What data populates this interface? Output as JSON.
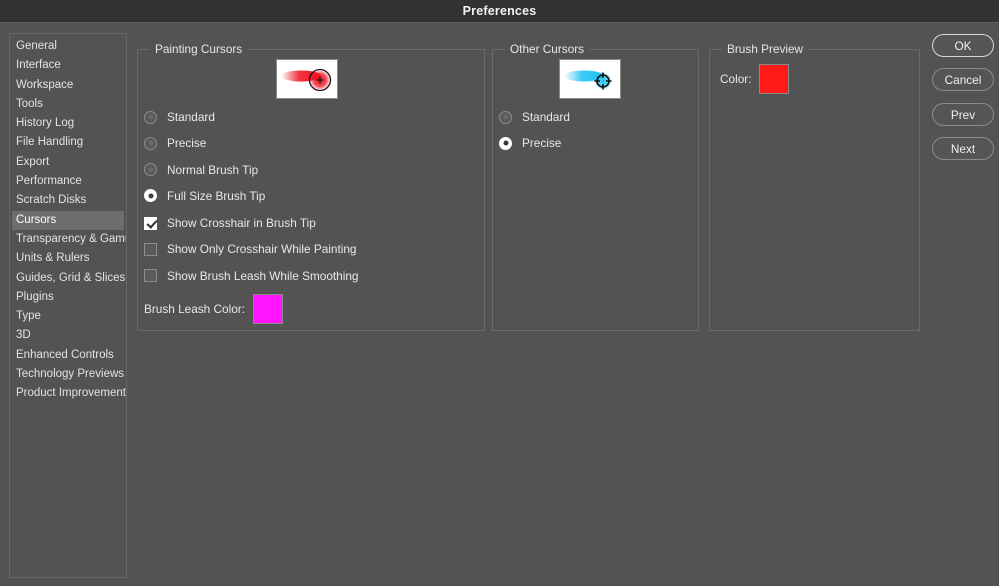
{
  "window": {
    "title": "Preferences"
  },
  "sidebar": {
    "items": [
      {
        "label": "General",
        "selected": false
      },
      {
        "label": "Interface",
        "selected": false
      },
      {
        "label": "Workspace",
        "selected": false
      },
      {
        "label": "Tools",
        "selected": false
      },
      {
        "label": "History Log",
        "selected": false
      },
      {
        "label": "File Handling",
        "selected": false
      },
      {
        "label": "Export",
        "selected": false
      },
      {
        "label": "Performance",
        "selected": false
      },
      {
        "label": "Scratch Disks",
        "selected": false
      },
      {
        "label": "Cursors",
        "selected": true
      },
      {
        "label": "Transparency & Gamut",
        "selected": false
      },
      {
        "label": "Units & Rulers",
        "selected": false
      },
      {
        "label": "Guides, Grid & Slices",
        "selected": false
      },
      {
        "label": "Plugins",
        "selected": false
      },
      {
        "label": "Type",
        "selected": false
      },
      {
        "label": "3D",
        "selected": false
      },
      {
        "label": "Enhanced Controls",
        "selected": false
      },
      {
        "label": "Technology Previews",
        "selected": false
      },
      {
        "label": "Product Improvement",
        "selected": false
      }
    ]
  },
  "painting_cursors": {
    "legend": "Painting Cursors",
    "preview_icon": "brush-stroke-red-with-crosshair-circle",
    "preview_stroke_color": "#f01020",
    "options": [
      {
        "label": "Standard",
        "selected": false
      },
      {
        "label": "Precise",
        "selected": false
      },
      {
        "label": "Normal Brush Tip",
        "selected": false
      },
      {
        "label": "Full Size Brush Tip",
        "selected": true
      }
    ],
    "checkboxes": [
      {
        "label": "Show Crosshair in Brush Tip",
        "checked": true
      },
      {
        "label": "Show Only Crosshair While Painting",
        "checked": false
      },
      {
        "label": "Show Brush Leash While Smoothing",
        "checked": false
      }
    ],
    "leash_color": {
      "label": "Brush Leash Color:",
      "value": "#ff15ff"
    }
  },
  "other_cursors": {
    "legend": "Other Cursors",
    "preview_icon": "brush-stroke-cyan-with-precise-target",
    "preview_stroke_color": "#1ac2f0",
    "options": [
      {
        "label": "Standard",
        "selected": false
      },
      {
        "label": "Precise",
        "selected": true
      }
    ]
  },
  "brush_preview": {
    "legend": "Brush Preview",
    "color": {
      "label": "Color:",
      "value": "#ff1a1a"
    }
  },
  "buttons": [
    {
      "label": "OK",
      "default": true
    },
    {
      "label": "Cancel",
      "default": false
    },
    {
      "label": "Prev",
      "default": false
    },
    {
      "label": "Next",
      "default": false
    }
  ]
}
